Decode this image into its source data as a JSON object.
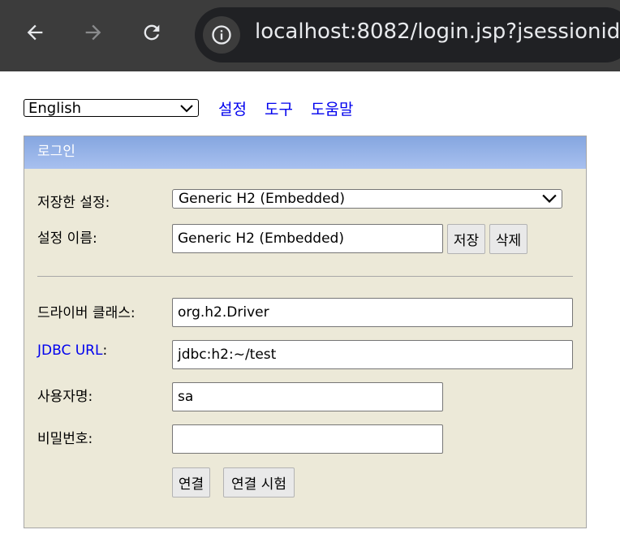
{
  "browser": {
    "url": "localhost:8082/login.jsp?jsessionid=",
    "back_icon": "arrow-left-icon",
    "forward_icon": "arrow-right-icon",
    "reload_icon": "reload-icon",
    "info_icon": "info-icon"
  },
  "toolbar": {
    "language": "English",
    "links": [
      "설정",
      "도구",
      "도움말"
    ]
  },
  "login": {
    "header": "로그인",
    "saved_settings_label": "저장한 설정:",
    "saved_settings_value": "Generic H2 (Embedded)",
    "setting_name_label": "설정 이름:",
    "setting_name_value": "Generic H2 (Embedded)",
    "save_button": "저장",
    "delete_button": "삭제",
    "driver_label": "드라이버 클래스:",
    "driver_value": "org.h2.Driver",
    "jdbc_label": "JDBC URL",
    "jdbc_colon": ":",
    "jdbc_value": "jdbc:h2:~/test",
    "username_label": "사용자명:",
    "username_value": "sa",
    "password_label": "비밀번호:",
    "password_value": "",
    "connect_button": "연결",
    "test_button": "연결 시험"
  },
  "colors": {
    "chrome_bg": "#3c3c3c",
    "omnibox_bg": "#202124",
    "panel_bg": "#ece9d8",
    "header_bg": "#93b1e8",
    "link": "#0000ee"
  }
}
